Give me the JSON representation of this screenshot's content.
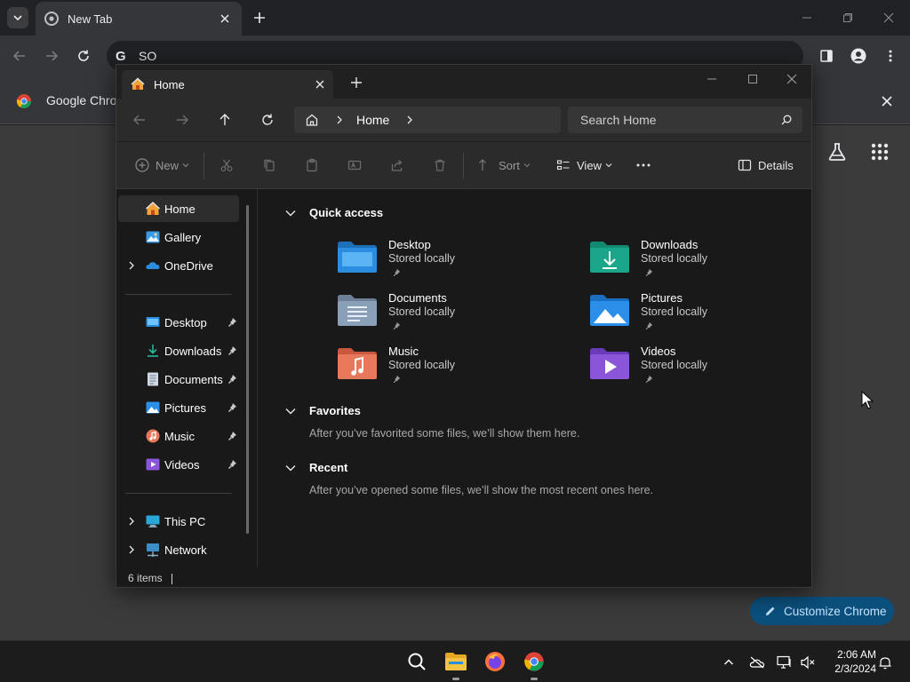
{
  "chrome": {
    "tab_title": "New Tab",
    "omnibox_text": "SO",
    "omnibox_logo": "G",
    "infobar_text": "Google Chron",
    "customize_label": "Customize Chrome"
  },
  "explorer": {
    "tab_title": "Home",
    "address_segment": "Home",
    "search_placeholder": "Search Home",
    "commands": {
      "new": "New",
      "sort": "Sort",
      "view": "View",
      "details": "Details"
    },
    "sidebar": {
      "top": [
        {
          "label": "Home",
          "icon": "home-icon"
        },
        {
          "label": "Gallery",
          "icon": "gallery-icon"
        },
        {
          "label": "OneDrive",
          "icon": "onedrive-icon"
        }
      ],
      "pinned": [
        {
          "label": "Desktop",
          "icon": "desktop-folder-icon"
        },
        {
          "label": "Downloads",
          "icon": "downloads-folder-icon"
        },
        {
          "label": "Documents",
          "icon": "documents-folder-icon"
        },
        {
          "label": "Pictures",
          "icon": "pictures-folder-icon"
        },
        {
          "label": "Music",
          "icon": "music-folder-icon"
        },
        {
          "label": "Videos",
          "icon": "videos-folder-icon"
        }
      ],
      "bottom": [
        {
          "label": "This PC",
          "icon": "this-pc-icon"
        },
        {
          "label": "Network",
          "icon": "network-icon"
        }
      ]
    },
    "sections": {
      "quick_access": "Quick access",
      "favorites": "Favorites",
      "favorites_hint": "After you’ve favorited some files, we’ll show them here.",
      "recent": "Recent",
      "recent_hint": "After you’ve opened some files, we’ll show the most recent ones here."
    },
    "quick_access": [
      {
        "name": "Desktop",
        "sub": "Stored locally",
        "color": "#2a8de0"
      },
      {
        "name": "Downloads",
        "sub": "Stored locally",
        "color": "#1aa68a"
      },
      {
        "name": "Documents",
        "sub": "Stored locally",
        "color": "#8aa0b8"
      },
      {
        "name": "Pictures",
        "sub": "Stored locally",
        "color": "#2b8ee8"
      },
      {
        "name": "Music",
        "sub": "Stored locally",
        "color": "#e8785a"
      },
      {
        "name": "Videos",
        "sub": "Stored locally",
        "color": "#8a55d8"
      }
    ],
    "status": "6 items"
  },
  "taskbar": {
    "time": "2:06 AM",
    "date": "2/3/2024"
  },
  "colors": {
    "accent": "#0b4f7c",
    "folder_yellow": "#f5c242"
  }
}
